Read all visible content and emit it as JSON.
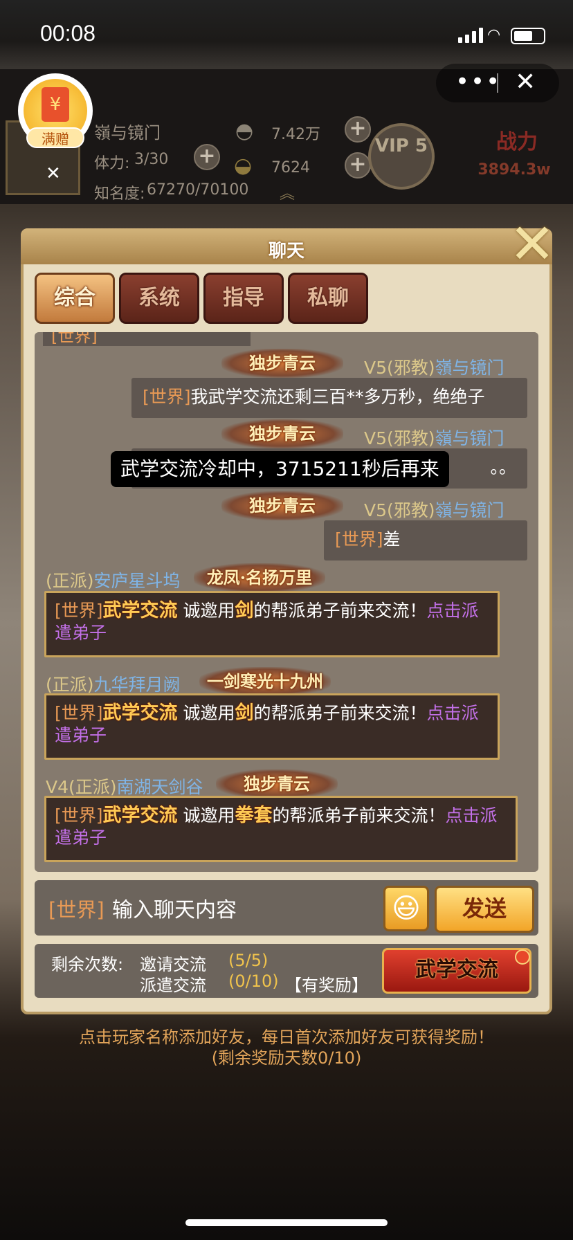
{
  "status_bar": {
    "time": "00:08"
  },
  "mini_program": {
    "more": "•••",
    "close": "✕"
  },
  "gift": {
    "label": "满赠",
    "icon": "red-envelope-icon",
    "close": "✕"
  },
  "player": {
    "name": "嶺与镜门",
    "stamina_label": "体力:",
    "stamina_value": "3/30",
    "fame_label": "知名度:",
    "fame_value": "67270/70100",
    "silver": "7.42万",
    "gold": "7624",
    "vip": "VIP 5",
    "power_label": "战力",
    "power_value": "3894.3w"
  },
  "dialog": {
    "title": "聊天",
    "close": "✕",
    "tabs": [
      {
        "label": "综合",
        "active": true
      },
      {
        "label": "系统",
        "active": false
      },
      {
        "label": "指导",
        "active": false
      },
      {
        "label": "私聊",
        "active": false
      }
    ]
  },
  "messages": {
    "top_partial": "[世界]",
    "m1": {
      "badge": "独步青云",
      "prefix": "V5(邪教)",
      "name": "嶺与镜门",
      "channel": "[世界]",
      "text": "我武学交流还剩三百**多万秒，绝绝子"
    },
    "m2": {
      "badge": "独步青云",
      "prefix": "V5(邪教)",
      "name": "嶺与镜门",
      "tail": "。。"
    },
    "m3": {
      "badge": "独步青云",
      "prefix": "V5(邪教)",
      "name": "嶺与镜门",
      "channel": "[世界]",
      "text": "差"
    },
    "s1": {
      "faction": "(正派)",
      "name": "安庐星斗坞",
      "badge": "龙凤·名扬万里",
      "channel": "[世界]",
      "kw": "武学交流",
      "t1": "诚邀用",
      "weapon": "剑",
      "t2": "的帮派弟子前来交流！",
      "link": "点击派遣弟子"
    },
    "s2": {
      "faction": "(正派)",
      "name": "九华拜月阙",
      "badge": "一剑寒光十九州",
      "channel": "[世界]",
      "kw": "武学交流",
      "t1": "诚邀用",
      "weapon": "剑",
      "t2": "的帮派弟子前来交流！",
      "link": "点击派遣弟子"
    },
    "s3": {
      "faction": "V4(正派)",
      "name": "南湖天剑谷",
      "badge": "独步青云",
      "channel": "[世界]",
      "kw": "武学交流",
      "t1": "诚邀用",
      "weapon": "拳套",
      "t2": "的帮派弟子前来交流！",
      "link": "点击派遣弟子"
    }
  },
  "toast": "武学交流冷却中，3715211秒后再来",
  "input": {
    "channel": "[世界]",
    "placeholder": "输入聊天内容",
    "emoji": "😃",
    "send": "发送"
  },
  "quota": {
    "label": "剩余次数:",
    "invite_label": "邀请交流",
    "invite_value": "(5/5)",
    "dispatch_label": "派遣交流",
    "dispatch_value": "(0/10)",
    "reward": "【有奖励】",
    "button": "武学交流"
  },
  "tip": {
    "line1": "点击玩家名称添加好友，每日首次添加好友可获得奖励！",
    "line2": "(剩余奖励天数0/10)"
  }
}
